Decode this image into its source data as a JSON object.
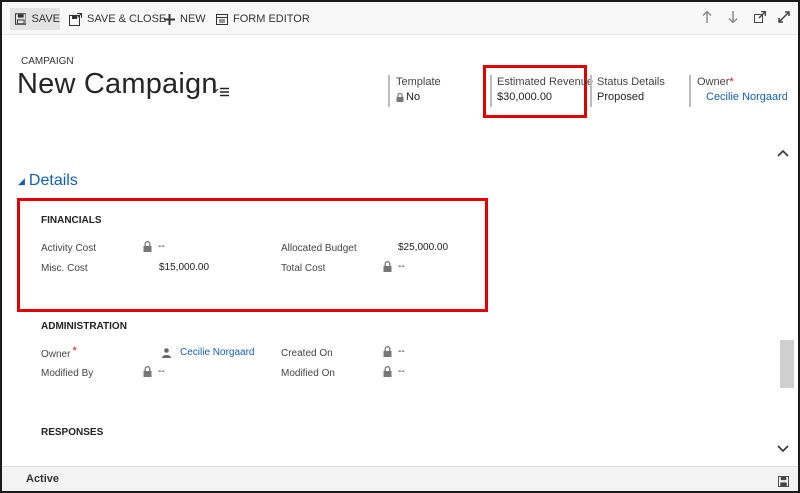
{
  "toolbar": {
    "save_label": "SAVE",
    "save_close_label": "SAVE & CLOSE",
    "new_label": "NEW",
    "form_editor_label": "FORM EDITOR"
  },
  "header": {
    "entity_type": "CAMPAIGN",
    "title": "New Campaign",
    "fields": {
      "template": {
        "label": "Template",
        "value": "No"
      },
      "estimated_revenue": {
        "label": "Estimated Revenue",
        "value": "$30,000.00"
      },
      "status_details": {
        "label": "Status Details",
        "value": "Proposed"
      },
      "owner": {
        "label": "Owner",
        "required": "*",
        "value": "Cecilie Norgaard"
      }
    }
  },
  "details": {
    "section_label": "Details",
    "financials": {
      "title": "FINANCIALS",
      "activity_cost": {
        "label": "Activity Cost",
        "value": "--"
      },
      "misc_cost": {
        "label": "Misc. Cost",
        "value": "$15,000.00"
      },
      "allocated_budget": {
        "label": "Allocated Budget",
        "value": "$25,000.00"
      },
      "total_cost": {
        "label": "Total Cost",
        "value": "--"
      }
    },
    "administration": {
      "title": "ADMINISTRATION",
      "owner": {
        "label": "Owner",
        "required": "*",
        "value": "Cecilie Norgaard"
      },
      "modified_by": {
        "label": "Modified By",
        "value": "--"
      },
      "created_on": {
        "label": "Created On",
        "value": "--"
      },
      "modified_on": {
        "label": "Modified On",
        "value": "--"
      }
    },
    "responses": {
      "title": "RESPONSES"
    }
  },
  "footer": {
    "status": "Active"
  },
  "colors": {
    "link": "#1160b7",
    "highlight": "#e30000",
    "required": "#e00000"
  },
  "icons": [
    "save-icon",
    "save-close-icon",
    "plus-icon",
    "form-editor-icon",
    "arrow-up-icon",
    "arrow-down-icon",
    "popout-icon",
    "maximize-icon",
    "lock-icon",
    "user-icon",
    "chevron-up-icon",
    "chevron-down-icon",
    "menu-icon"
  ]
}
